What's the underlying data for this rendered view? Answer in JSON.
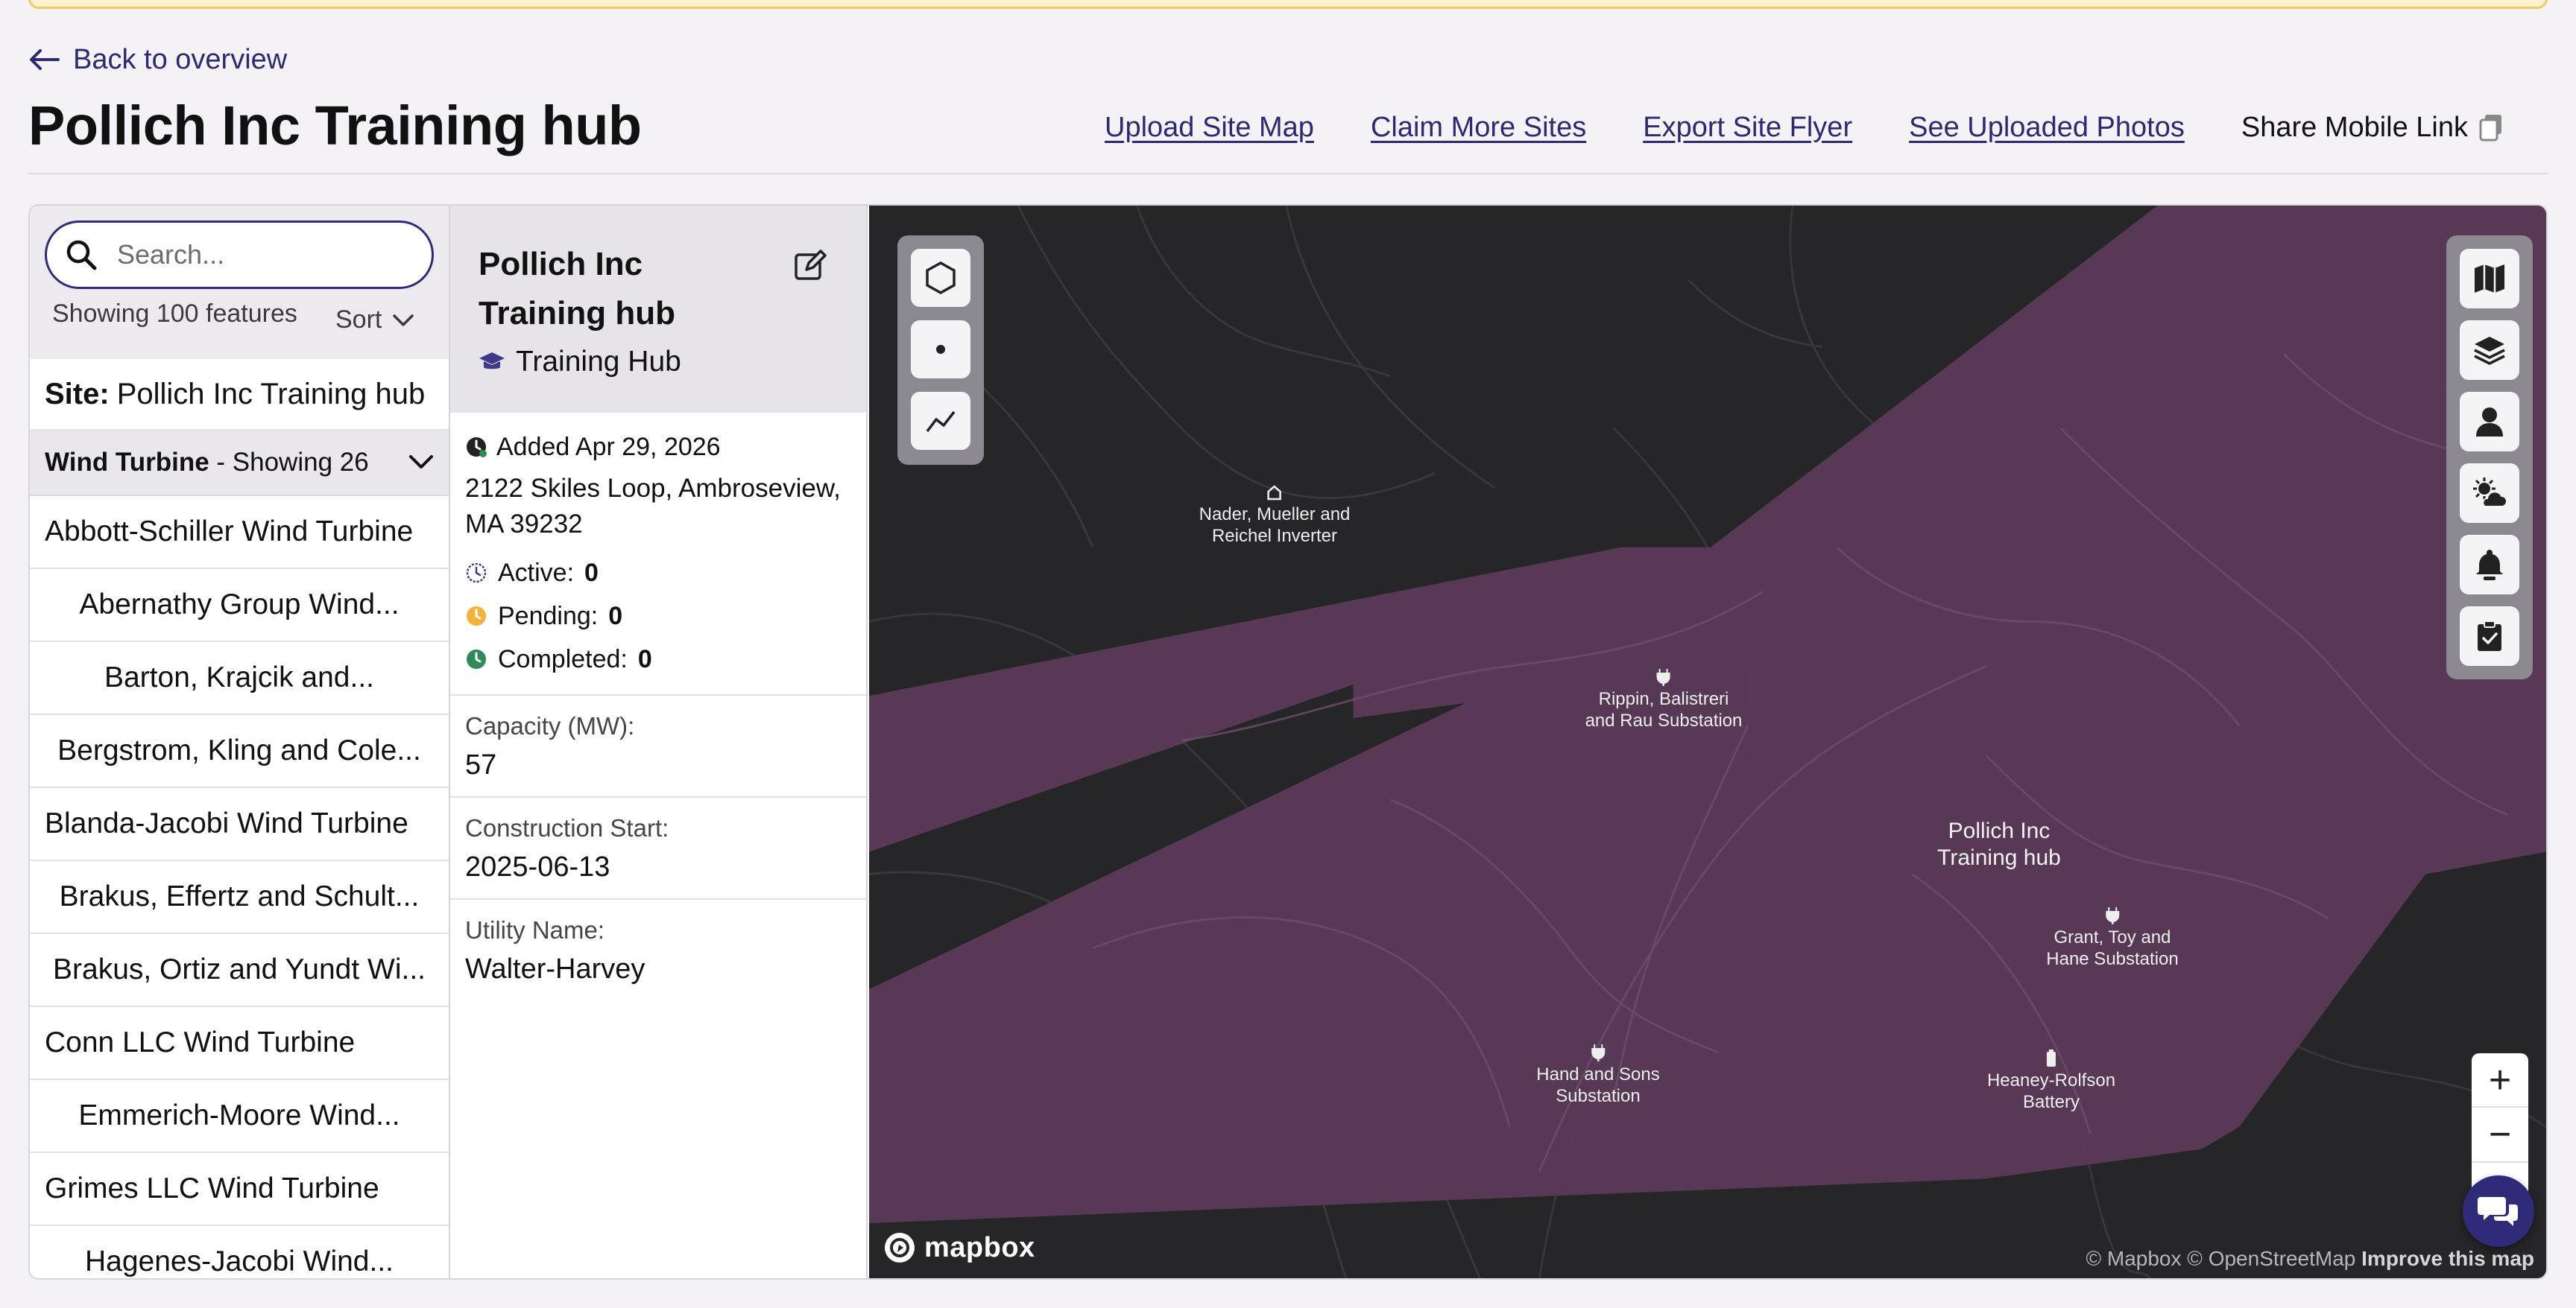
{
  "nav": {
    "back_label": "Back to overview"
  },
  "page": {
    "title": "Pollich Inc Training hub"
  },
  "top_links": {
    "upload_site_map": "Upload Site Map",
    "claim_more_sites": "Claim More Sites",
    "export_site_flyer": "Export Site Flyer",
    "see_uploaded_photos": "See Uploaded Photos",
    "share_mobile_link": "Share Mobile Link"
  },
  "list": {
    "search_placeholder": "Search...",
    "showing": "Showing 100 features",
    "sort_label": "Sort",
    "site_prefix": "Site:",
    "site_name": "Pollich Inc Training hub",
    "group_name": "Wind Turbine",
    "group_count": "- Showing 26",
    "items": [
      "Abbott-Schiller Wind Turbine",
      "Abernathy Group Wind...",
      "Barton, Krajcik and...",
      "Bergstrom, Kling and Cole...",
      "Blanda-Jacobi Wind Turbine",
      "Brakus, Effertz and Schult...",
      "Brakus, Ortiz and Yundt Wi...",
      "Conn LLC Wind Turbine",
      "Emmerich-Moore Wind...",
      "Grimes LLC Wind Turbine",
      "Hagenes-Jacobi Wind..."
    ]
  },
  "detail": {
    "title": "Pollich Inc Training hub",
    "type": "Training Hub",
    "added": "Added Apr 29, 2026",
    "address": "2122 Skiles Loop, Ambroseview, MA 39232",
    "active_label": "Active:",
    "active_value": "0",
    "pending_label": "Pending:",
    "pending_value": "0",
    "completed_label": "Completed:",
    "completed_value": "0",
    "capacity_label": "Capacity (MW):",
    "capacity_value": "57",
    "construction_label": "Construction Start:",
    "construction_value": "2025-06-13",
    "utility_label": "Utility Name:",
    "utility_value": "Walter-Harvey"
  },
  "map": {
    "labels": {
      "nader_line1": "Nader, Mueller and",
      "nader_line2": "Reichel Inverter",
      "rippin_line1": "Rippin, Balistreri",
      "rippin_line2": "and Rau Substation",
      "hub_line1": "Pollich Inc",
      "hub_line2": "Training hub",
      "grant_line1": "Grant, Toy and",
      "grant_line2": "Hane Substation",
      "hand_line1": "Hand and Sons",
      "hand_line2": "Substation",
      "heaney_line1": "Heaney-Rolfson",
      "heaney_line2": "Battery"
    },
    "zoom_in": "+",
    "zoom_out": "−",
    "logo_text": "mapbox",
    "attribution": "© Mapbox © OpenStreetMap",
    "improve": "Improve this map"
  },
  "colors": {
    "brand": "#2e2b78",
    "territory": "#5a3a57",
    "map_bg": "#262528",
    "pending": "#f0b43c",
    "completed": "#2f8a5a",
    "active": "#3d3a8a"
  }
}
